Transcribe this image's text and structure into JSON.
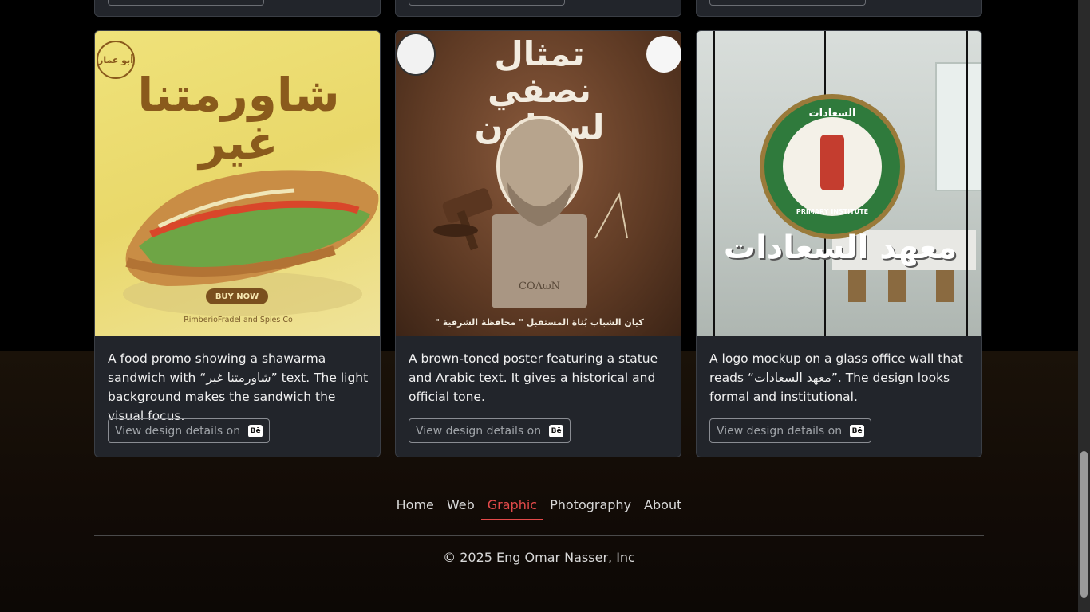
{
  "cards": [
    {
      "image_alt": "Shawarma sandwich promo",
      "image_text": {
        "title": "شاورمتنا غير",
        "logo": "أبو عمار",
        "cta": "BUY NOW",
        "credit": "RimberioFradel and Spies Co"
      },
      "description": "A food promo showing a shawarma sandwich with “شاورمتنا غير” text. The light background makes the sandwich the visual focus.",
      "button_label": "View design details on",
      "button_icon": "behance-icon"
    },
    {
      "image_alt": "Brown-toned statue poster",
      "image_text": {
        "title": "تمثال نصفي لسولون",
        "footer": "كيان الشباب بُناة المستقبل \" محافظة الشرقية \"",
        "plaque": "COΛωN"
      },
      "description": "A brown-toned poster featuring a statue and Arabic text. It gives a historical and official tone.",
      "button_label": "View design details on",
      "button_icon": "behance-icon"
    },
    {
      "image_alt": "Logo mockup on glass office wall",
      "image_text": {
        "title": "معهد السعادات",
        "emblem_top": "السعادات",
        "emblem_bottom": "PRIMARY INSTITUTE"
      },
      "description": "A logo mockup on a glass office wall that reads “معهد السعادات”. The design looks formal and institutional.",
      "button_label": "View design details on",
      "button_icon": "behance-icon"
    }
  ],
  "nav": {
    "items": [
      {
        "label": "Home",
        "active": false
      },
      {
        "label": "Web",
        "active": false
      },
      {
        "label": "Graphic",
        "active": true
      },
      {
        "label": "Photography",
        "active": false
      },
      {
        "label": "About",
        "active": false
      }
    ]
  },
  "footer": {
    "copyright": "© 2025 Eng Omar Nasser, Inc"
  },
  "colors": {
    "accent": "#e34a4a",
    "card_bg": "#22252b",
    "page_bg": "#000000"
  }
}
